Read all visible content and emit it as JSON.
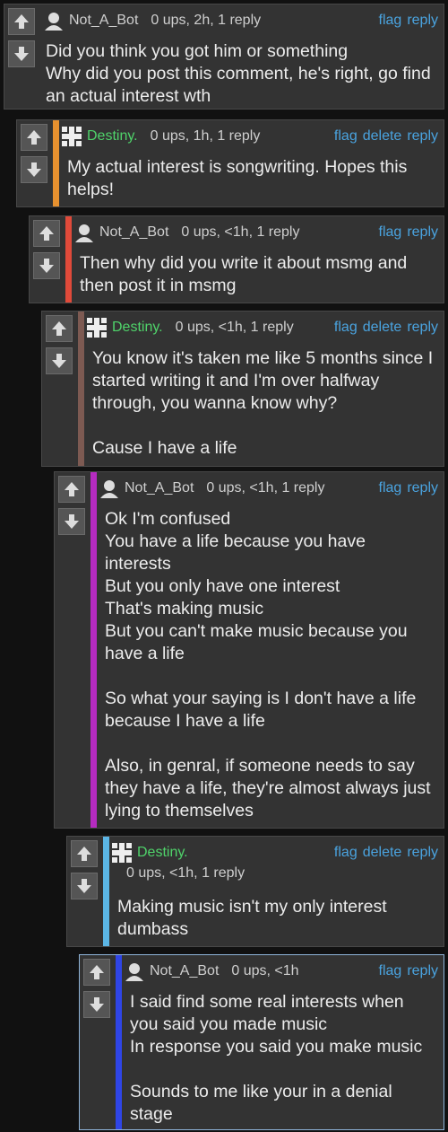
{
  "actions": {
    "flag": "flag",
    "delete": "delete",
    "reply": "reply"
  },
  "comments": [
    {
      "user": "Not_A_Bot",
      "meta": "0 ups, 2h, 1 reply",
      "stripe": "#333333",
      "lines": [
        "Did you think you got him or something",
        "Why did you post this comment, he's right, go find an actual interest wth"
      ]
    },
    {
      "user": "Destiny.",
      "meta": "0 ups, 1h, 1 reply",
      "stripe": "#e7912f",
      "lines": [
        "My actual interest is songwriting. Hopes this helps!"
      ]
    },
    {
      "user": "Not_A_Bot",
      "meta": "0 ups, <1h, 1 reply",
      "stripe": "#e04a3a",
      "lines": [
        "Then why did you write it about msmg and then post it in msmg"
      ]
    },
    {
      "user": "Destiny.",
      "meta": "0 ups, <1h, 1 reply",
      "stripe": "#7d5a52",
      "lines": [
        "You know it's taken me like 5 months since I started writing it and I'm over halfway through, you wanna know why?",
        "",
        "Cause I have a life"
      ]
    },
    {
      "user": "Not_A_Bot",
      "meta": "0 ups, <1h, 1 reply",
      "stripe": "#b52bc0",
      "lines": [
        "Ok I'm confused",
        "You have a life because you have interests",
        "But you only have one interest",
        "That's making music",
        "But you can't make music because you have a life",
        "",
        "So what your saying is I don't have a life because I have a life",
        "",
        "Also, in genral, if someone needs to say they have a life, they're almost always just lying to themselves"
      ]
    },
    {
      "user": "Destiny.",
      "meta": "0 ups, <1h, 1 reply",
      "stripe": "#5bb6e6",
      "lines": [
        "Making music isn't my only interest dumbass"
      ]
    },
    {
      "user": "Not_A_Bot",
      "meta": "0 ups, <1h",
      "stripe": "#2f45e6",
      "lines": [
        "I said find some real interests when you said you made music",
        "In response you said you make music",
        "",
        "Sounds to me like your in a denial stage"
      ]
    }
  ]
}
